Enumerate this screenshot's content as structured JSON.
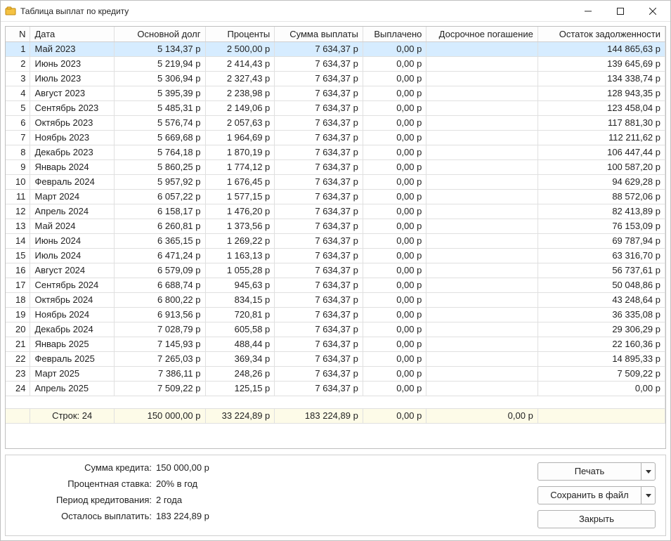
{
  "window": {
    "title": "Таблица выплат по кредиту"
  },
  "columns": {
    "n": "N",
    "date": "Дата",
    "principal": "Основной долг",
    "interest": "Проценты",
    "payment": "Сумма выплаты",
    "paid": "Выплачено",
    "early": "Досрочное погашение",
    "balance": "Остаток задолженности"
  },
  "rows": [
    {
      "n": "1",
      "date": "Май 2023",
      "principal": "5 134,37 р",
      "interest": "2 500,00 р",
      "payment": "7 634,37 р",
      "paid": "0,00 р",
      "early": "",
      "balance": "144 865,63 р"
    },
    {
      "n": "2",
      "date": "Июнь 2023",
      "principal": "5 219,94 р",
      "interest": "2 414,43 р",
      "payment": "7 634,37 р",
      "paid": "0,00 р",
      "early": "",
      "balance": "139 645,69 р"
    },
    {
      "n": "3",
      "date": "Июль 2023",
      "principal": "5 306,94 р",
      "interest": "2 327,43 р",
      "payment": "7 634,37 р",
      "paid": "0,00 р",
      "early": "",
      "balance": "134 338,74 р"
    },
    {
      "n": "4",
      "date": "Август 2023",
      "principal": "5 395,39 р",
      "interest": "2 238,98 р",
      "payment": "7 634,37 р",
      "paid": "0,00 р",
      "early": "",
      "balance": "128 943,35 р"
    },
    {
      "n": "5",
      "date": "Сентябрь 2023",
      "principal": "5 485,31 р",
      "interest": "2 149,06 р",
      "payment": "7 634,37 р",
      "paid": "0,00 р",
      "early": "",
      "balance": "123 458,04 р"
    },
    {
      "n": "6",
      "date": "Октябрь 2023",
      "principal": "5 576,74 р",
      "interest": "2 057,63 р",
      "payment": "7 634,37 р",
      "paid": "0,00 р",
      "early": "",
      "balance": "117 881,30 р"
    },
    {
      "n": "7",
      "date": "Ноябрь 2023",
      "principal": "5 669,68 р",
      "interest": "1 964,69 р",
      "payment": "7 634,37 р",
      "paid": "0,00 р",
      "early": "",
      "balance": "112 211,62 р"
    },
    {
      "n": "8",
      "date": "Декабрь 2023",
      "principal": "5 764,18 р",
      "interest": "1 870,19 р",
      "payment": "7 634,37 р",
      "paid": "0,00 р",
      "early": "",
      "balance": "106 447,44 р"
    },
    {
      "n": "9",
      "date": "Январь 2024",
      "principal": "5 860,25 р",
      "interest": "1 774,12 р",
      "payment": "7 634,37 р",
      "paid": "0,00 р",
      "early": "",
      "balance": "100 587,20 р"
    },
    {
      "n": "10",
      "date": "Февраль 2024",
      "principal": "5 957,92 р",
      "interest": "1 676,45 р",
      "payment": "7 634,37 р",
      "paid": "0,00 р",
      "early": "",
      "balance": "94 629,28 р"
    },
    {
      "n": "11",
      "date": "Март 2024",
      "principal": "6 057,22 р",
      "interest": "1 577,15 р",
      "payment": "7 634,37 р",
      "paid": "0,00 р",
      "early": "",
      "balance": "88 572,06 р"
    },
    {
      "n": "12",
      "date": "Апрель 2024",
      "principal": "6 158,17 р",
      "interest": "1 476,20 р",
      "payment": "7 634,37 р",
      "paid": "0,00 р",
      "early": "",
      "balance": "82 413,89 р"
    },
    {
      "n": "13",
      "date": "Май 2024",
      "principal": "6 260,81 р",
      "interest": "1 373,56 р",
      "payment": "7 634,37 р",
      "paid": "0,00 р",
      "early": "",
      "balance": "76 153,09 р"
    },
    {
      "n": "14",
      "date": "Июнь 2024",
      "principal": "6 365,15 р",
      "interest": "1 269,22 р",
      "payment": "7 634,37 р",
      "paid": "0,00 р",
      "early": "",
      "balance": "69 787,94 р"
    },
    {
      "n": "15",
      "date": "Июль 2024",
      "principal": "6 471,24 р",
      "interest": "1 163,13 р",
      "payment": "7 634,37 р",
      "paid": "0,00 р",
      "early": "",
      "balance": "63 316,70 р"
    },
    {
      "n": "16",
      "date": "Август 2024",
      "principal": "6 579,09 р",
      "interest": "1 055,28 р",
      "payment": "7 634,37 р",
      "paid": "0,00 р",
      "early": "",
      "balance": "56 737,61 р"
    },
    {
      "n": "17",
      "date": "Сентябрь 2024",
      "principal": "6 688,74 р",
      "interest": "945,63 р",
      "payment": "7 634,37 р",
      "paid": "0,00 р",
      "early": "",
      "balance": "50 048,86 р"
    },
    {
      "n": "18",
      "date": "Октябрь 2024",
      "principal": "6 800,22 р",
      "interest": "834,15 р",
      "payment": "7 634,37 р",
      "paid": "0,00 р",
      "early": "",
      "balance": "43 248,64 р"
    },
    {
      "n": "19",
      "date": "Ноябрь 2024",
      "principal": "6 913,56 р",
      "interest": "720,81 р",
      "payment": "7 634,37 р",
      "paid": "0,00 р",
      "early": "",
      "balance": "36 335,08 р"
    },
    {
      "n": "20",
      "date": "Декабрь 2024",
      "principal": "7 028,79 р",
      "interest": "605,58 р",
      "payment": "7 634,37 р",
      "paid": "0,00 р",
      "early": "",
      "balance": "29 306,29 р"
    },
    {
      "n": "21",
      "date": "Январь 2025",
      "principal": "7 145,93 р",
      "interest": "488,44 р",
      "payment": "7 634,37 р",
      "paid": "0,00 р",
      "early": "",
      "balance": "22 160,36 р"
    },
    {
      "n": "22",
      "date": "Февраль 2025",
      "principal": "7 265,03 р",
      "interest": "369,34 р",
      "payment": "7 634,37 р",
      "paid": "0,00 р",
      "early": "",
      "balance": "14 895,33 р"
    },
    {
      "n": "23",
      "date": "Март 2025",
      "principal": "7 386,11 р",
      "interest": "248,26 р",
      "payment": "7 634,37 р",
      "paid": "0,00 р",
      "early": "",
      "balance": "7 509,22 р"
    },
    {
      "n": "24",
      "date": "Апрель 2025",
      "principal": "7 509,22 р",
      "interest": "125,15 р",
      "payment": "7 634,37 р",
      "paid": "0,00 р",
      "early": "",
      "balance": "0,00 р"
    }
  ],
  "summary": {
    "row_count_label": "Строк: 24",
    "principal": "150 000,00 р",
    "interest": "33 224,89 р",
    "payment": "183 224,89 р",
    "paid": "0,00 р",
    "early": "0,00 р",
    "balance": ""
  },
  "info": {
    "loan_amount_label": "Сумма кредита:",
    "loan_amount_value": "150 000,00 р",
    "rate_label": "Процентная ставка:",
    "rate_value": "20% в год",
    "period_label": "Период кредитования:",
    "period_value": "2 года",
    "remaining_label": "Осталось выплатить:",
    "remaining_value": "183 224,89 р"
  },
  "buttons": {
    "print": "Печать",
    "save": "Сохранить в файл",
    "close": "Закрыть"
  }
}
